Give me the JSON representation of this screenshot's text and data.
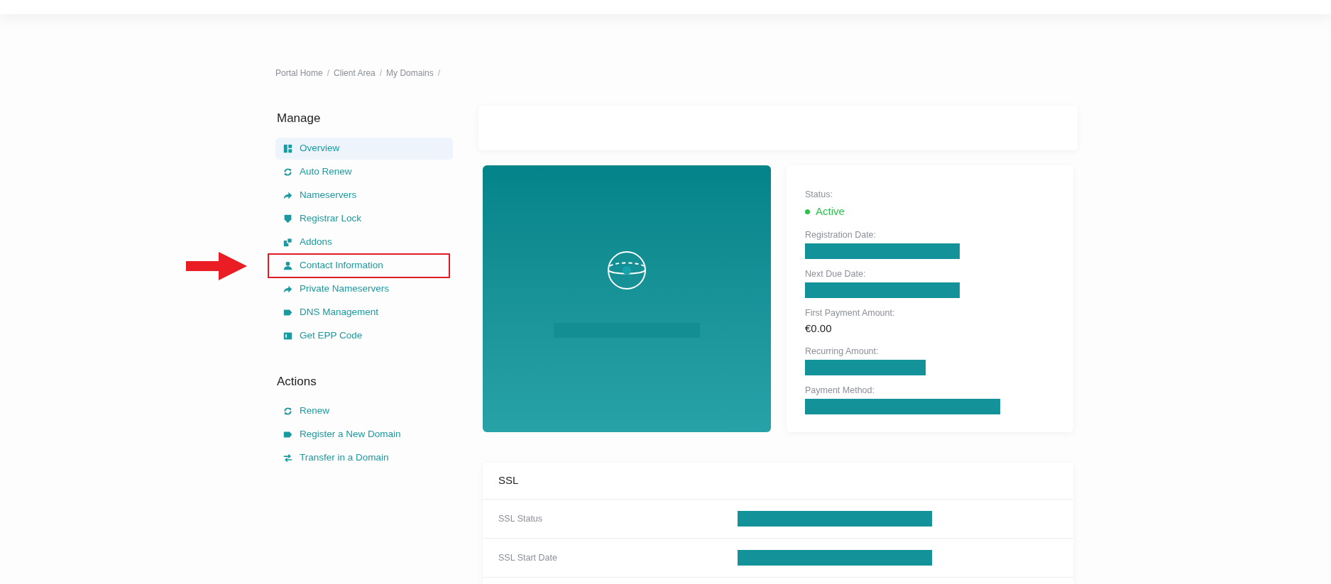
{
  "breadcrumb": [
    {
      "label": "Portal Home",
      "separator": "/"
    },
    {
      "label": "Client Area",
      "separator": "/"
    },
    {
      "label": "My Domains",
      "separator": "/"
    }
  ],
  "sidebar": [
    {
      "title": "Manage",
      "items": [
        {
          "label": "Overview",
          "selected": true,
          "highlighted": false
        },
        {
          "label": "Auto Renew",
          "selected": false,
          "highlighted": false
        },
        {
          "label": "Nameservers",
          "selected": false,
          "highlighted": false
        },
        {
          "label": "Registrar Lock",
          "selected": false,
          "highlighted": false
        },
        {
          "label": "Addons",
          "selected": false,
          "highlighted": false
        },
        {
          "label": "Contact Information",
          "selected": false,
          "highlighted": true
        },
        {
          "label": "Private Nameservers",
          "selected": false,
          "highlighted": false
        },
        {
          "label": "DNS Management",
          "selected": false,
          "highlighted": false
        },
        {
          "label": "Get EPP Code",
          "selected": false,
          "highlighted": false
        }
      ]
    },
    {
      "title": "Actions",
      "items": [
        {
          "label": "Renew",
          "selected": false,
          "highlighted": false
        },
        {
          "label": "Register a New Domain",
          "selected": false,
          "highlighted": false
        },
        {
          "label": "Transfer in a Domain",
          "selected": false,
          "highlighted": false
        }
      ]
    }
  ],
  "details": [
    {
      "label": "Status:",
      "kind": "status",
      "value": "Active",
      "color": "#2fbf4f"
    },
    {
      "label": "Registration Date:",
      "kind": "redacted"
    },
    {
      "label": "Next Due Date:",
      "kind": "redacted"
    },
    {
      "label": "First Payment Amount:",
      "kind": "text",
      "value": "€0.00"
    },
    {
      "label": "Recurring Amount:",
      "kind": "redacted"
    },
    {
      "label": "Payment Method:",
      "kind": "redacted"
    }
  ],
  "ssl": {
    "title": "SSL",
    "rows": [
      {
        "label": "SSL Status"
      },
      {
        "label": "SSL Start Date"
      }
    ]
  }
}
